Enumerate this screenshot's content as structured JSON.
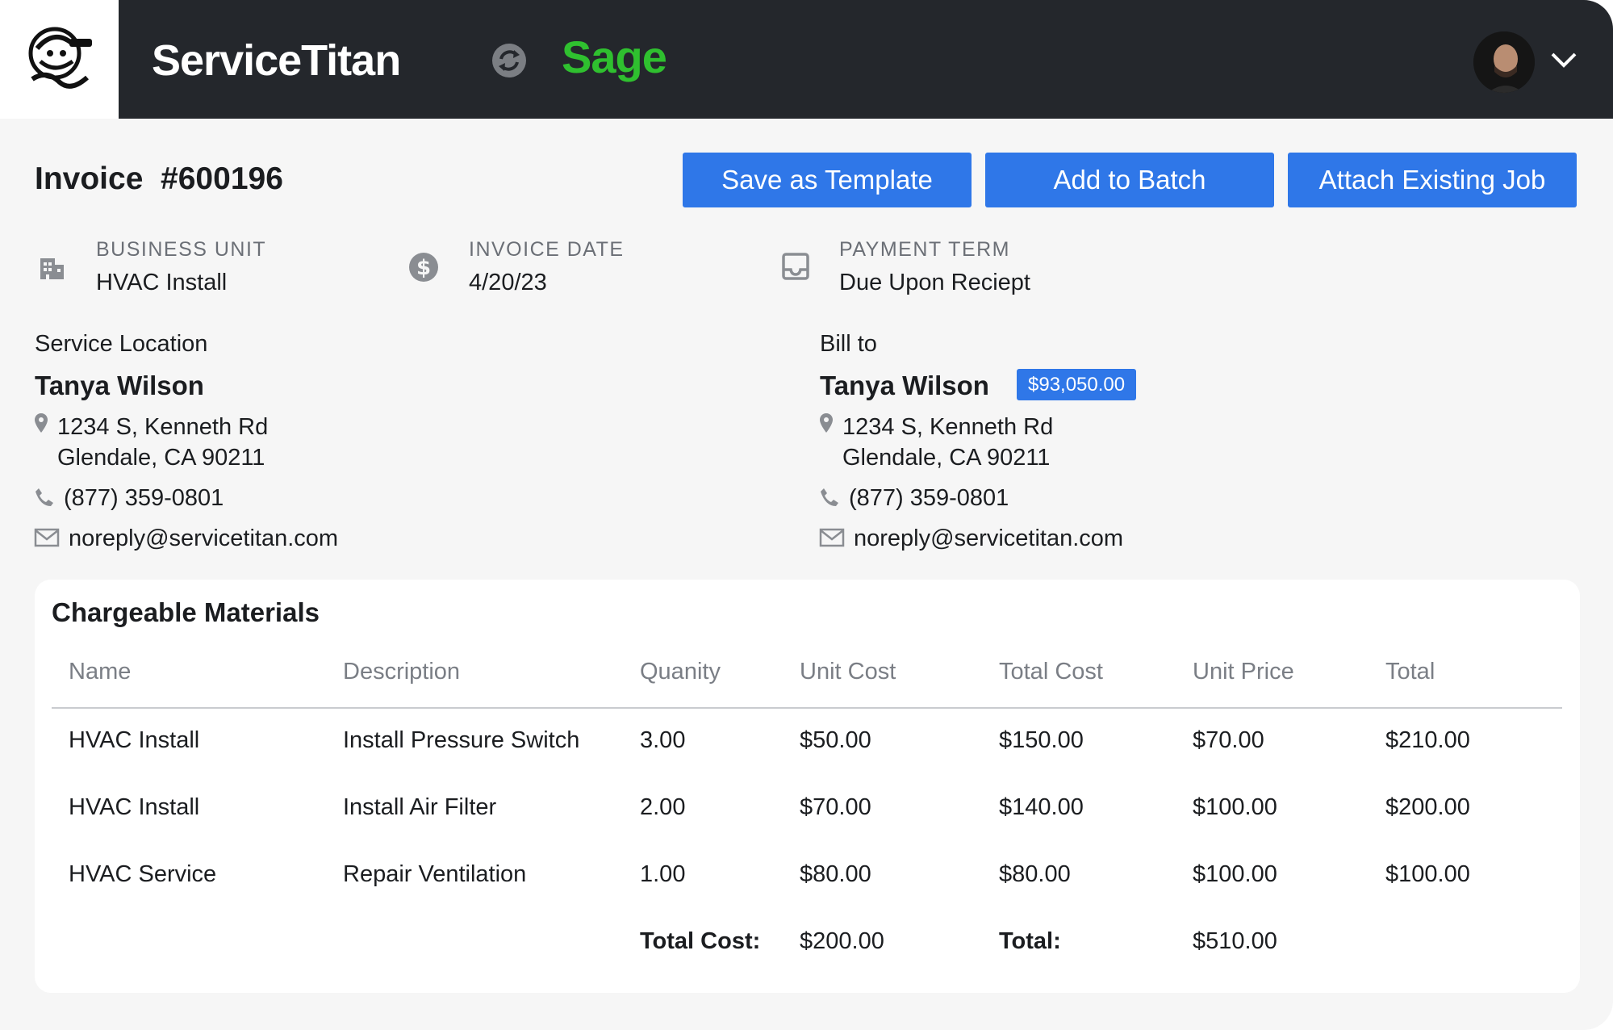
{
  "app": {
    "brand": "ServiceTitan",
    "partner": "Sage",
    "colors": {
      "topbar": "#24272c",
      "accent": "#2f77e8",
      "sage_green": "#2fc02f"
    }
  },
  "invoice": {
    "title": "Invoice  #600196",
    "buttons": {
      "save_template": "Save as Template",
      "add_batch": "Add to Batch",
      "attach_job": "Attach Existing Job"
    },
    "meta": {
      "business_unit": {
        "label": "BUSINESS UNIT",
        "value": "HVAC Install",
        "icon": "building-icon"
      },
      "invoice_date": {
        "label": "INVOICE DATE",
        "value": "4/20/23",
        "icon": "dollar-icon"
      },
      "payment_term": {
        "label": "PAYMENT TERM",
        "value": "Due Upon Reciept",
        "icon": "inbox-icon"
      }
    }
  },
  "service_location": {
    "label": "Service Location",
    "name": "Tanya Wilson",
    "address_line1": "1234 S, Kenneth Rd",
    "address_line2": "Glendale, CA 90211",
    "phone": "(877) 359-0801",
    "email": "noreply@servicetitan.com"
  },
  "bill_to": {
    "label": "Bill to",
    "name": "Tanya Wilson",
    "balance": "$93,050.00",
    "address_line1": "1234 S, Kenneth Rd",
    "address_line2": "Glendale, CA 90211",
    "phone": "(877) 359-0801",
    "email": "noreply@servicetitan.com"
  },
  "materials": {
    "title": "Chargeable Materials",
    "columns": [
      "Name",
      "Description",
      "Quanity",
      "Unit Cost",
      "Total Cost",
      "Unit Price",
      "Total"
    ],
    "rows": [
      [
        "HVAC Install",
        "Install Pressure Switch",
        "3.00",
        "$50.00",
        "$150.00",
        "$70.00",
        "$210.00"
      ],
      [
        "HVAC Install",
        "Install Air Filter",
        "2.00",
        "$70.00",
        "$140.00",
        "$100.00",
        "$200.00"
      ],
      [
        "HVAC Service",
        "Repair Ventilation",
        "1.00",
        "$80.00",
        "$80.00",
        "$100.00",
        "$100.00"
      ]
    ],
    "footer": {
      "total_cost_label": "Total Cost:",
      "total_cost_value": "$200.00",
      "total_label": "Total:",
      "total_value": "$510.00"
    }
  }
}
